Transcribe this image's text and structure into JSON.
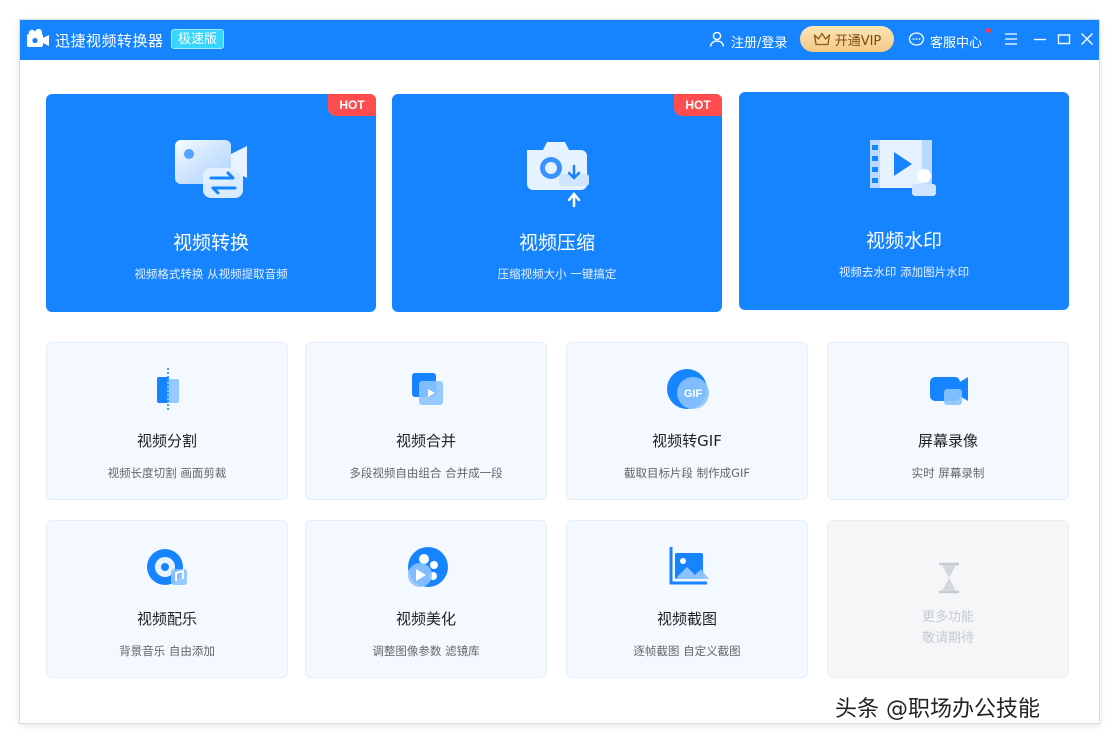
{
  "titlebar": {
    "app_title": "迅捷视频转换器",
    "edition_badge": "极速版",
    "login_label": "注册/登录",
    "vip_label": "开通VIP",
    "service_label": "客服中心",
    "colors": {
      "bar": "#1784ff",
      "vip_bg": "#f3c885",
      "notice_dot": "#ff3b3b"
    }
  },
  "big_cards": [
    {
      "title": "视频转换",
      "desc": "视频格式转换 从视频提取音频",
      "badge": "HOT",
      "icon": "video-convert-icon"
    },
    {
      "title": "视频压缩",
      "desc": "压缩视频大小 一键搞定",
      "badge": "HOT",
      "icon": "video-compress-icon"
    },
    {
      "title": "视频水印",
      "desc": "视频去水印 添加图片水印",
      "badge": "",
      "icon": "video-watermark-icon"
    }
  ],
  "small_cards": [
    {
      "title": "视频分割",
      "desc": "视频长度切割 画面剪裁",
      "icon": "video-split-icon"
    },
    {
      "title": "视频合并",
      "desc": "多段视频自由组合 合并成一段",
      "icon": "video-merge-icon"
    },
    {
      "title": "视频转GIF",
      "desc": "截取目标片段 制作成GIF",
      "icon": "gif-icon"
    },
    {
      "title": "屏幕录像",
      "desc": "实时 屏幕录制",
      "icon": "screen-record-icon"
    },
    {
      "title": "视频配乐",
      "desc": "背景音乐 自由添加",
      "icon": "music-icon"
    },
    {
      "title": "视频美化",
      "desc": "调整图像参数 滤镜库",
      "icon": "beautify-icon"
    },
    {
      "title": "视频截图",
      "desc": "逐帧截图 自定义截图",
      "icon": "screenshot-icon"
    }
  ],
  "more_card": {
    "line1": "更多功能",
    "line2": "敬请期待",
    "icon": "hourglass-icon"
  },
  "watermark_text": "头条 @职场办公技能"
}
